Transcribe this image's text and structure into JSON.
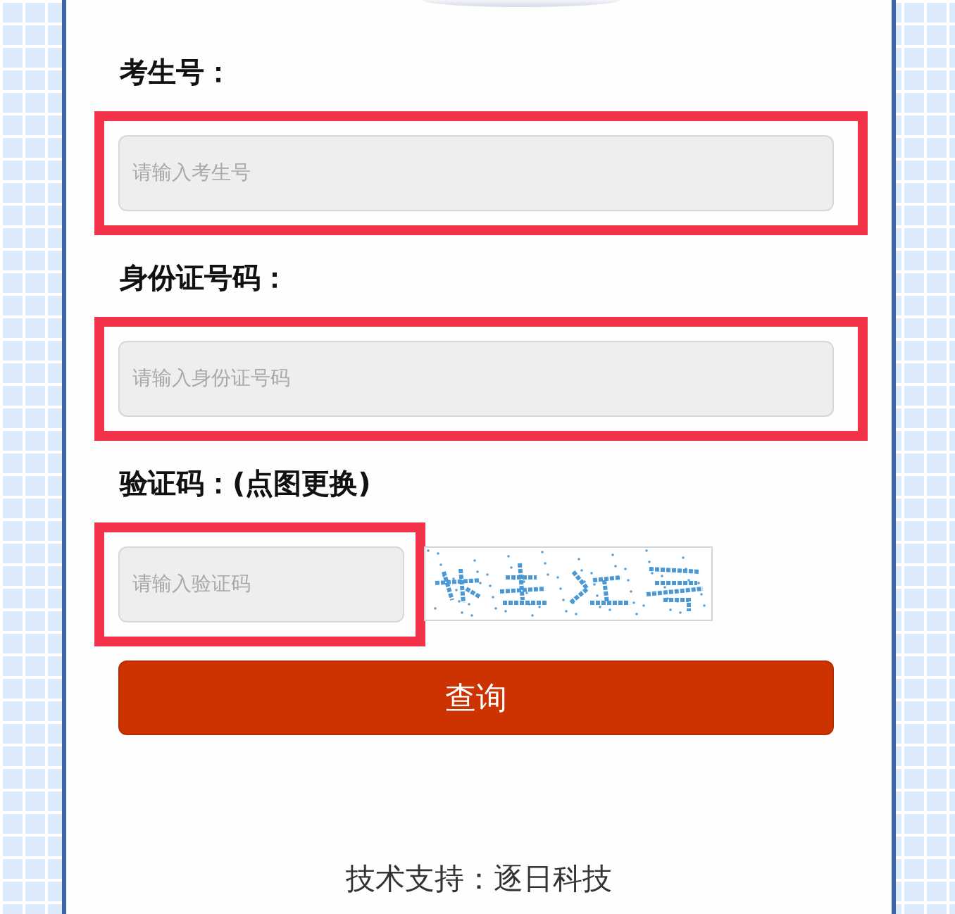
{
  "form": {
    "fields": [
      {
        "kind": "text",
        "label": "考生号：",
        "placeholder": "请输入考生号",
        "highlighted": true
      },
      {
        "kind": "text",
        "label": "身份证号码：",
        "placeholder": "请输入身份证号码",
        "highlighted": true
      },
      {
        "kind": "captcha",
        "label": "验证码：(点图更换)",
        "placeholder": "请输入验证码",
        "highlighted": true
      }
    ]
  },
  "submit_button": {
    "label": "查询"
  },
  "footer": {
    "text": "技术支持：逐日科技"
  }
}
